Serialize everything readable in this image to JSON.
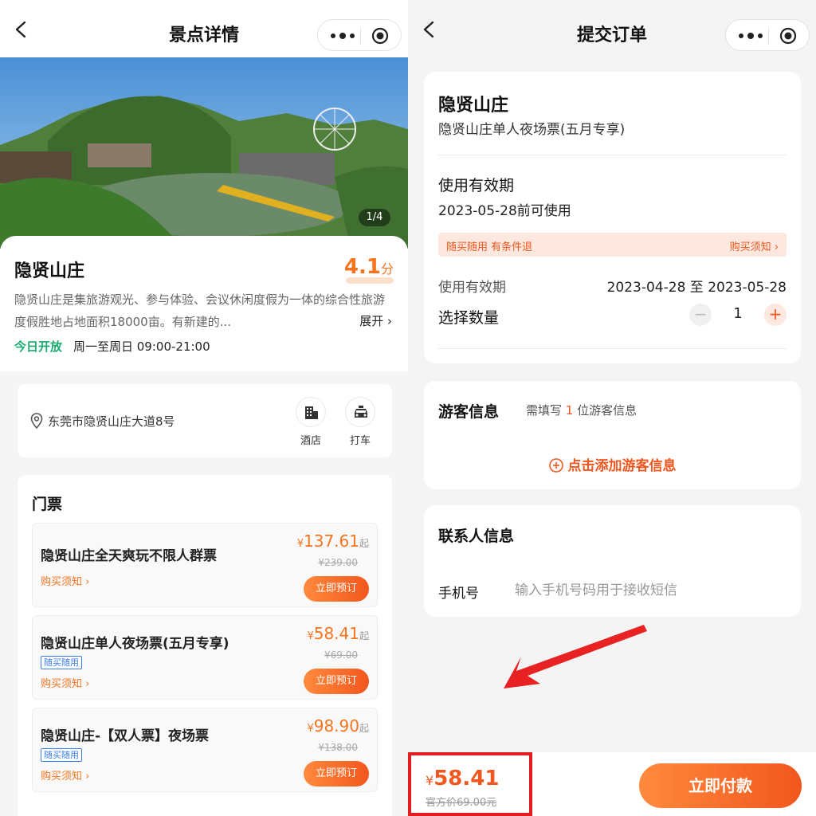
{
  "left": {
    "nav": {
      "title": "景点详情"
    },
    "gallery": {
      "counter": "1/4"
    },
    "attraction": {
      "name": "隐贤山庄",
      "score_num": "4.1",
      "score_unit": "分",
      "description": "隐贤山庄是集旅游观光、参与体验、会议休闲度假为一体的综合性旅游度假胜地占地面积18000亩。有新建的...",
      "expand_label": "展开 ›",
      "open_status": "今日开放",
      "open_hours": "周一至周日 09:00-21:00"
    },
    "address": {
      "text": "东莞市隐贤山庄大道8号",
      "actions": [
        {
          "label": "酒店",
          "icon": "building-icon"
        },
        {
          "label": "打车",
          "icon": "car-icon"
        }
      ]
    },
    "tickets": {
      "heading": "门票",
      "items": [
        {
          "name": "隐贤山庄全天爽玩不限人群票",
          "currency": "¥",
          "price": "137.61",
          "qi": "起",
          "original": "¥239.00",
          "tag": "",
          "notice": "购买须知 ›",
          "button": "立即预订"
        },
        {
          "name": "隐贤山庄单人夜场票(五月专享)",
          "currency": "¥",
          "price": "58.41",
          "qi": "起",
          "original": "¥69.00",
          "tag": "随买随用",
          "notice": "购买须知 ›",
          "button": "立即预订"
        },
        {
          "name": "隐贤山庄-【双人票】夜场票",
          "currency": "¥",
          "price": "98.90",
          "qi": "起",
          "original": "¥138.00",
          "tag": "随买随用",
          "notice": "购买须知 ›",
          "button": "立即预订"
        }
      ]
    }
  },
  "right": {
    "nav": {
      "title": "提交订单"
    },
    "order": {
      "title": "隐贤山庄",
      "subtitle": "隐贤山庄单人夜场票(五月专享)",
      "validity_heading": "使用有效期",
      "validity_value": "2023-05-28前可使用",
      "policy_left": "随买随用  有条件退",
      "policy_right": "购买须知 ›",
      "range_label": "使用有效期",
      "range_value": "2023-04-28 至 2023-05-28",
      "quantity_label": "选择数量",
      "quantity": "1",
      "minus": "−",
      "plus": "+"
    },
    "guest": {
      "heading": "游客信息",
      "hint_pre": "需填写 ",
      "hint_count": "1",
      "hint_post": " 位游客信息",
      "add_label": "点击添加游客信息"
    },
    "contact": {
      "heading": "联系人信息",
      "phone_label": "手机号",
      "phone_value": "",
      "phone_placeholder": "输入手机号码用于接收短信"
    },
    "footer": {
      "currency": "¥",
      "price": "58.41",
      "original": "官方价69.00元",
      "pay_button": "立即付款"
    }
  },
  "colors": {
    "accent": "#f7741f",
    "accent_dark": "#f0561d",
    "open_green": "#1aaa6e",
    "highlight_red": "#e21d1d",
    "tag_blue": "#3b7de8"
  }
}
